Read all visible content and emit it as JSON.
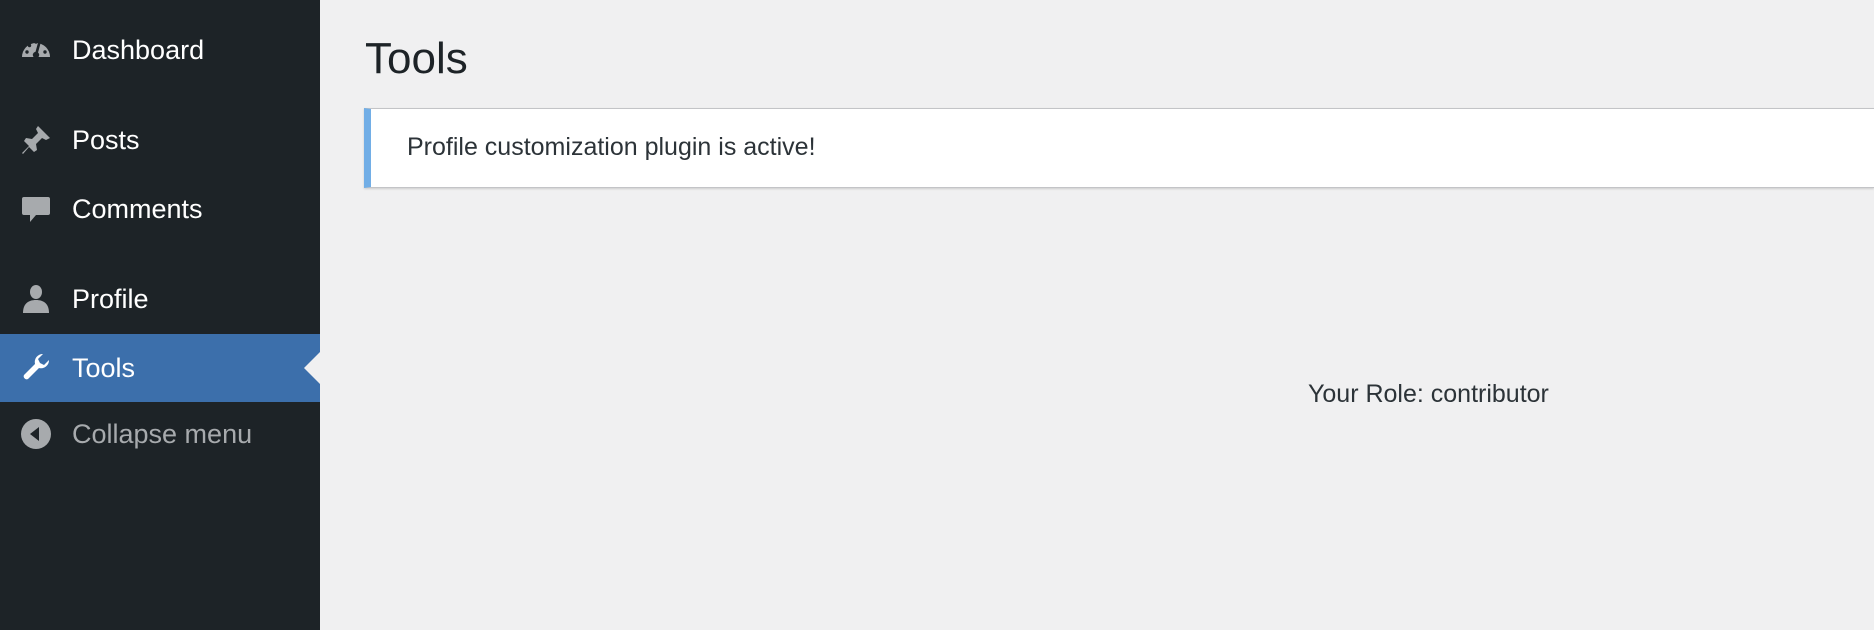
{
  "sidebar": {
    "items": [
      {
        "label": "Dashboard",
        "icon": "dashboard-icon"
      },
      {
        "label": "Posts",
        "icon": "pushpin-icon"
      },
      {
        "label": "Comments",
        "icon": "comment-icon"
      },
      {
        "label": "Profile",
        "icon": "user-icon"
      },
      {
        "label": "Tools",
        "icon": "wrench-icon",
        "current": true
      },
      {
        "label": "Collapse menu",
        "icon": "collapse-arrow-icon"
      }
    ]
  },
  "main": {
    "title": "Tools",
    "notice": "Profile customization plugin is active!",
    "role_text": "Your Role: contributor"
  },
  "colors": {
    "sidebar_bg": "#1d2327",
    "current_item_bg": "#3c6fab",
    "content_bg": "#f0f0f1",
    "notice_border": "#72aee6"
  }
}
